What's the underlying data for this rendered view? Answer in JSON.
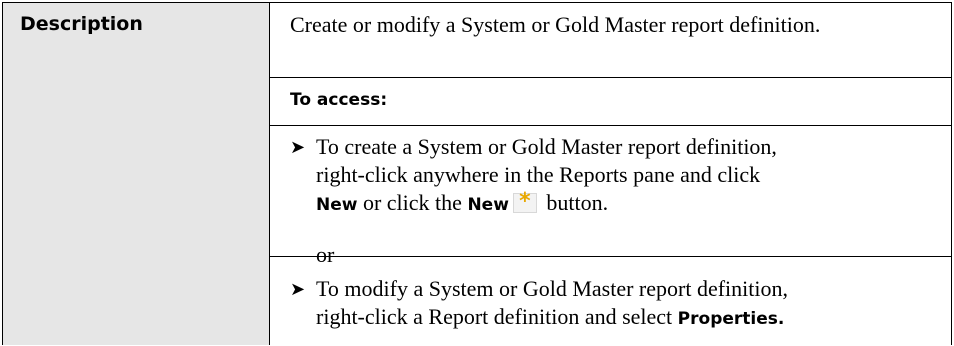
{
  "label": "Description",
  "intro": "Create or modify a System or Gold Master report definition.",
  "access_heading": "To access:",
  "bullet_glyph": "➤",
  "item1": {
    "line1": "To create a System or Gold Master report definition,",
    "line2": "right-click anywhere in the Reports pane and click",
    "new1": "New",
    "mid": " or click the ",
    "new2": "New",
    "end": " button."
  },
  "or_text": "or",
  "item2": {
    "line1": "To modify a System or Gold Master report definition,",
    "line2": "right-click a Report definition and select ",
    "properties": "Properties."
  },
  "icons": {
    "new_button": "new-star-icon",
    "star_color": "#e8a800"
  }
}
